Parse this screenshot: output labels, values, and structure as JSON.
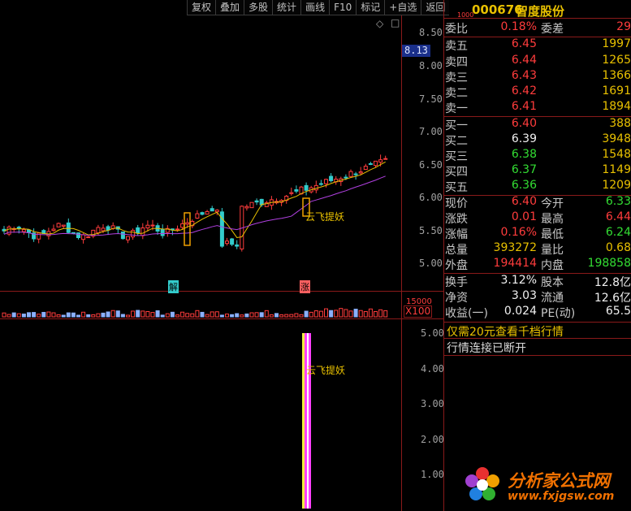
{
  "toolbar": {
    "buttons": [
      "复权",
      "叠加",
      "多股",
      "统计",
      "画线",
      "F10",
      "标记",
      "+自选",
      "返回"
    ]
  },
  "price_chart": {
    "y_ticks": [
      "8.50",
      "8.00",
      "7.50",
      "7.00",
      "6.50",
      "6.00",
      "5.50",
      "5.00"
    ],
    "current_price_tag": "8.13",
    "signal_label": "云飞提妖",
    "markers": [
      "解",
      "涨"
    ],
    "diamond": "◇",
    "close_symbol": "□",
    "volume_unit": "X100",
    "volume_max_tick": "15000"
  },
  "indicator_chart": {
    "y_ticks": [
      "5.00",
      "4.00",
      "3.00",
      "2.00",
      "1.00"
    ],
    "signal_label": "云飞提妖"
  },
  "quote": {
    "code_prefix": "1000",
    "code": "000676",
    "name": "智度股份",
    "webi_label": "委比",
    "webi_value": "0.18%",
    "weicha_label": "委差",
    "weicha_value": "29",
    "sell": [
      {
        "label": "卖五",
        "price": "6.45",
        "vol": "1997"
      },
      {
        "label": "卖四",
        "price": "6.44",
        "vol": "1265"
      },
      {
        "label": "卖三",
        "price": "6.43",
        "vol": "1366"
      },
      {
        "label": "卖二",
        "price": "6.42",
        "vol": "1691"
      },
      {
        "label": "卖一",
        "price": "6.41",
        "vol": "1894"
      }
    ],
    "buy": [
      {
        "label": "买一",
        "price": "6.40",
        "vol": "388"
      },
      {
        "label": "买二",
        "price": "6.39",
        "vol": "3948"
      },
      {
        "label": "买三",
        "price": "6.38",
        "vol": "1548"
      },
      {
        "label": "买四",
        "price": "6.37",
        "vol": "1149"
      },
      {
        "label": "买五",
        "price": "6.36",
        "vol": "1209"
      }
    ],
    "stats": [
      {
        "l1": "现价",
        "v1": "6.40",
        "l2": "今开",
        "v2": "6.33"
      },
      {
        "l1": "涨跌",
        "v1": "0.01",
        "l2": "最高",
        "v2": "6.44"
      },
      {
        "l1": "涨幅",
        "v1": "0.16%",
        "l2": "最低",
        "v2": "6.24"
      },
      {
        "l1": "总量",
        "v1": "393272",
        "l2": "量比",
        "v2": "0.68"
      },
      {
        "l1": "外盘",
        "v1": "194414",
        "l2": "内盘",
        "v2": "198858"
      }
    ],
    "fund": [
      {
        "l1": "换手",
        "v1": "3.12%",
        "l2": "股本",
        "v2": "12.8亿"
      },
      {
        "l1": "净资",
        "v1": "3.03",
        "l2": "流通",
        "v2": "12.6亿"
      },
      {
        "l1": "收益(一)",
        "v1": "0.024",
        "l2": "PE(动)",
        "v2": "65.5"
      }
    ],
    "promo": "仅需20元查看千档行情",
    "status": "行情连接已断开"
  },
  "watermark": {
    "site_name": "分析家公式网",
    "url": "www.fxjgsw.com"
  },
  "colors": {
    "up": "#ff3c3c",
    "down": "#33dd33",
    "ma_yellow": "#e8c000",
    "ma_purple": "#b040e0",
    "grid": "#8a1a1a"
  }
}
